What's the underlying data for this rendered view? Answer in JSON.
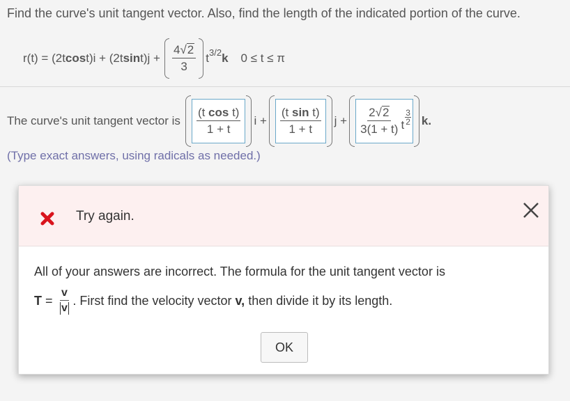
{
  "question": {
    "instruction": "Find the curve's unit tangent vector. Also, find the length of the indicated portion of the curve.",
    "r_lhs": "r(t) = (2t ",
    "r_cos": "cos",
    "r_mid": " t)i + (2t ",
    "r_sin": "sin",
    "r_mid2": " t)j +",
    "r_coef_num": "4",
    "r_coef_rad": "2",
    "r_coef_den": "3",
    "r_exp": "3/2",
    "r_tpow": "t",
    "r_k": "k",
    "r_range": "0 ≤ t ≤ π"
  },
  "answer": {
    "prompt": "The curve's unit tangent vector is",
    "i_num_pre": "(t ",
    "i_num_fn": "cos",
    "i_num_post": " t)",
    "i_den": "1 + t",
    "i_label": "i +",
    "j_num_pre": "(t ",
    "j_num_fn": "sin",
    "j_num_post": " t)",
    "j_den": "1 + t",
    "j_label": "j +",
    "k_num_coef": "2",
    "k_num_rad": "2",
    "k_den": "3(1 + t)",
    "k_tpow": "t",
    "k_exp_num": "3",
    "k_exp_den": "2",
    "k_label": "k.",
    "hint": "(Type exact answers, using radicals as needed.)"
  },
  "dialog": {
    "status": "Try again.",
    "message_line1": "All of your answers are incorrect. The formula for the unit tangent vector is",
    "formula_T": "T",
    "formula_eq": " = ",
    "formula_num": "v",
    "formula_den": "v",
    "message_line2_a": ". First find the velocity vector ",
    "message_line2_v": "v,",
    "message_line2_b": " then divide it by its length.",
    "ok_label": "OK",
    "colors": {
      "error": "#d9141d",
      "header_bg": "#fdf0f0",
      "input_border": "#6aa8c9",
      "hint": "#6f6fa8"
    },
    "icons": {
      "status": "x-mark-icon",
      "close": "close-icon"
    }
  }
}
